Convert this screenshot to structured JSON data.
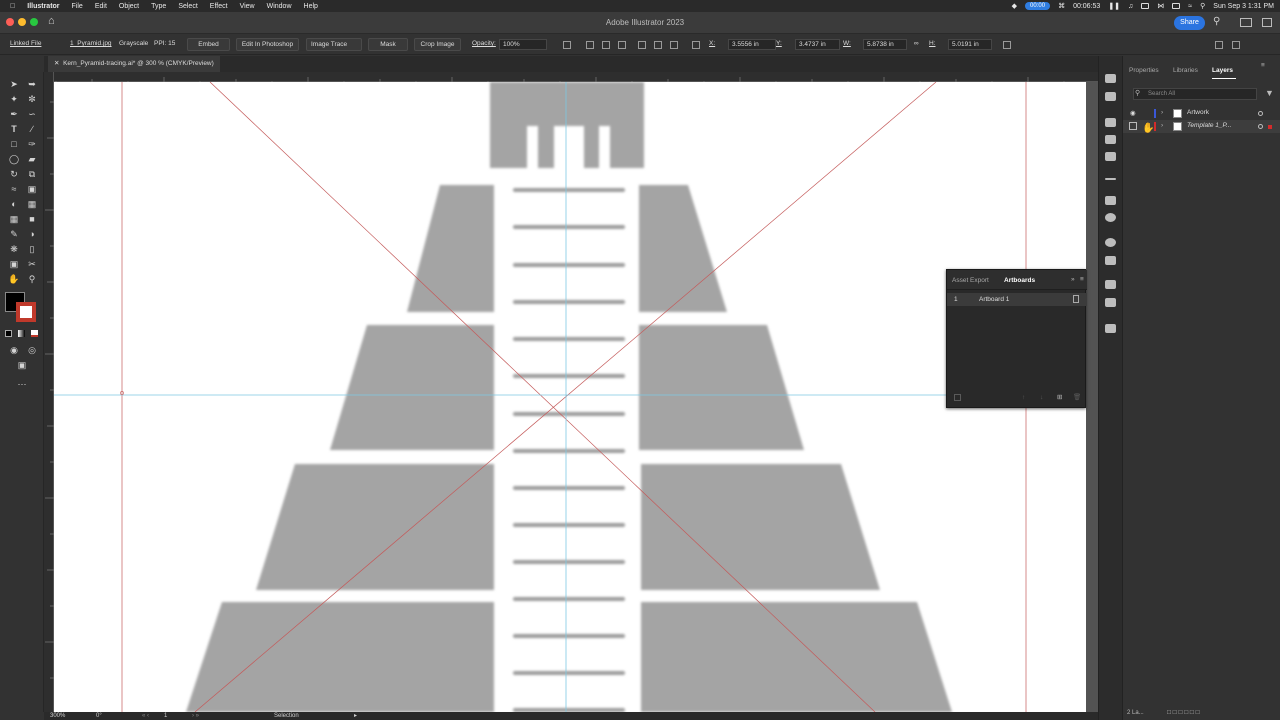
{
  "menubar": {
    "app_name": "Illustrator",
    "items": [
      "File",
      "Edit",
      "Object",
      "Type",
      "Select",
      "Effect",
      "View",
      "Window",
      "Help"
    ],
    "recording_time": "00:00",
    "timer": "00:06:53",
    "datetime": "Sun Sep 3  1:31 PM"
  },
  "titlebar": {
    "title": "Adobe Illustrator 2023",
    "share_label": "Share"
  },
  "controlbar": {
    "linked_file": "Linked File",
    "filename": "1_Pyramid.jpg",
    "color_mode": "Grayscale",
    "ppi": "PPI: 15",
    "embed": "Embed",
    "edit_photoshop": "Edit In Photoshop",
    "image_trace": "Image Trace",
    "mask": "Mask",
    "crop_image": "Crop Image",
    "opacity_label": "Opacity:",
    "opacity_value": "100%",
    "x_label": "X:",
    "x_value": "3.5556 in",
    "y_label": "Y:",
    "y_value": "3.4737 in",
    "w_label": "W:",
    "w_value": "5.8738 in",
    "h_label": "H:",
    "h_value": "5.0191 in"
  },
  "document": {
    "tab_title": "Kern_Pyramid-tracing.ai* @ 300 % (CMYK/Preview)"
  },
  "statusbar": {
    "zoom": "300%",
    "rotation": "0°",
    "artboard_num": "1",
    "tool": "Selection"
  },
  "panels": {
    "tabs": [
      "Properties",
      "Libraries",
      "Layers"
    ],
    "active_tab": "Layers",
    "search_placeholder": "Search All",
    "layers": [
      {
        "name": "Artwork",
        "color": "#3a57d8"
      },
      {
        "name": "Template 1_P...",
        "color": "#d42b2b"
      }
    ],
    "layer_count": "2 La..."
  },
  "artboards_panel": {
    "tabs": [
      "Asset Export",
      "Artboards"
    ],
    "active_tab": "Artboards",
    "rows": [
      {
        "num": "1",
        "name": "Artboard 1"
      }
    ]
  },
  "colors": {
    "accent": "#2b74e0",
    "guide_blue": "#7ec8e3",
    "guide_red": "#c45a5a",
    "pyramid_gray": "#a4a4a4"
  }
}
